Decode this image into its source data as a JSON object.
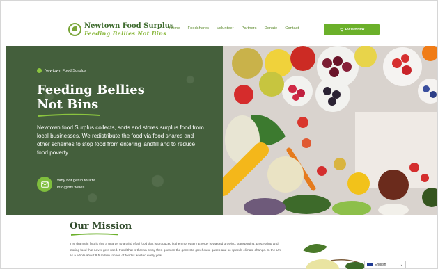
{
  "header": {
    "logo_title": "Newtown Food Surplus",
    "logo_subtitle": "Feeding Bellies Not Bins",
    "nav": [
      "Home",
      "Foodshares",
      "Volunteer",
      "Partners",
      "Donate",
      "Contact"
    ],
    "donate_button": "Donate Now"
  },
  "hero": {
    "kicker": "Newtown Food Surplus",
    "title_line1": "Feeding Bellies",
    "title_line2": "Not Bins",
    "lede": "Newtown food Surplus collects, sorts and stores surplus food from local businesses. We redistribute the food via food shares and other schemes to stop food from entering landfill and to reduce food poverty.",
    "contact_label": "Why not get in touch!",
    "contact_email": "info@nfs.wales"
  },
  "mission": {
    "title": "Our Mission",
    "text": "The dramatic fact is that a quarter to a third of all food that is produced is then not eaten! Energy is wasted growing, transporting, processing and storing food that never gets used. Food that is thrown away then goes on the generate greehouse gases and so speeds climate change. In the UK as a whole about 9.5 million tonnes of food is wasted every year."
  },
  "language": {
    "label": "English"
  },
  "colors": {
    "brand_green": "#6bb02a",
    "hero_bg": "#445f3c",
    "dark_title": "#2f4a2a"
  }
}
